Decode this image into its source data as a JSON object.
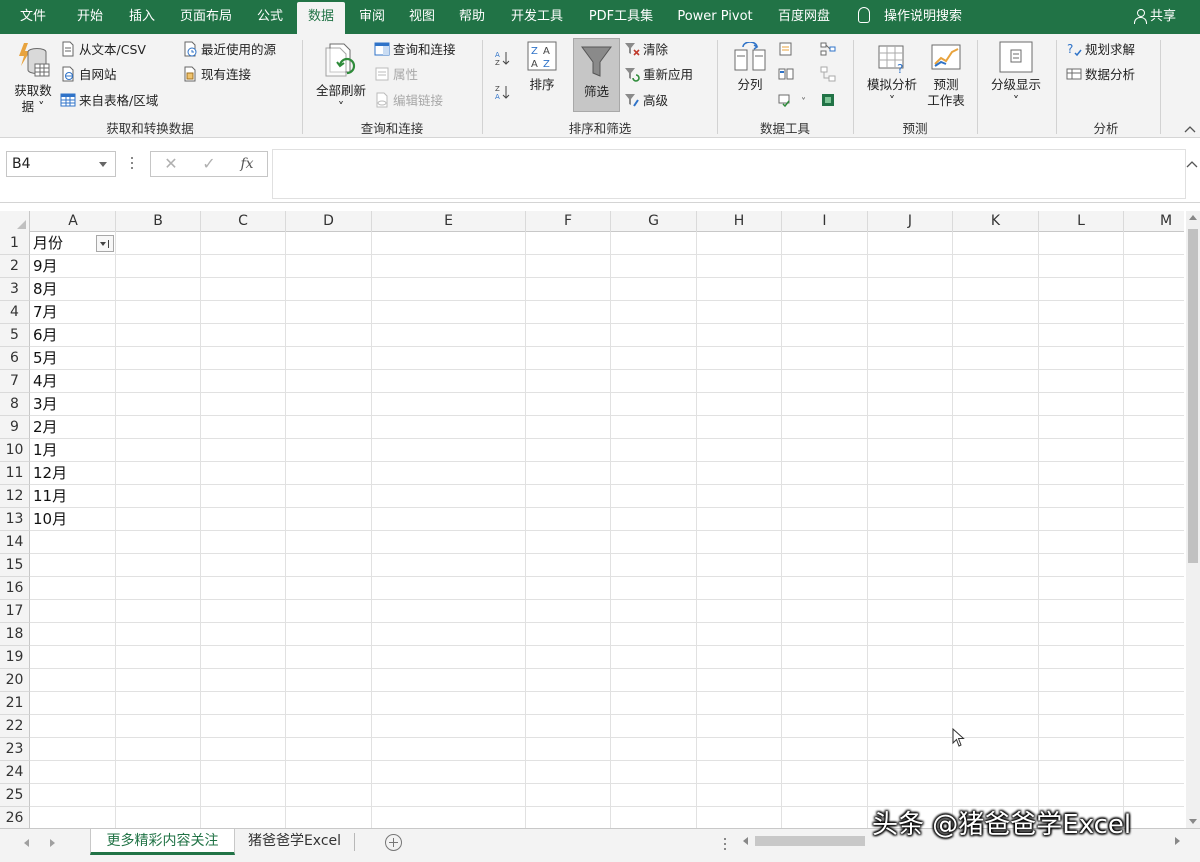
{
  "ribbon_tabs": [
    "文件",
    "开始",
    "插入",
    "页面布局",
    "公式",
    "数据",
    "审阅",
    "视图",
    "帮助",
    "开发工具",
    "PDF工具集",
    "Power Pivot",
    "百度网盘"
  ],
  "active_tab": "数据",
  "tell_me": "操作说明搜索",
  "share": "共享",
  "theme_color": "#217346",
  "groups": {
    "get_transform": {
      "label": "获取和转换数据",
      "get_data_line1": "获取数",
      "get_data_line2": "据 ˅",
      "from_text": "从文本/CSV",
      "from_web": "自网站",
      "from_table": "来自表格/区域",
      "recent_sources": "最近使用的源",
      "existing_connections": "现有连接"
    },
    "queries": {
      "label": "查询和连接",
      "refresh_all": "全部刷新",
      "queries_connections": "查询和连接",
      "properties": "属性",
      "edit_links": "编辑链接"
    },
    "sort_filter": {
      "label": "排序和筛选",
      "sort": "排序",
      "filter": "筛选",
      "clear": "清除",
      "reapply": "重新应用",
      "advanced": "高级"
    },
    "data_tools": {
      "label": "数据工具",
      "text_to_columns": "分列"
    },
    "forecast": {
      "label": "预测",
      "what_if": "模拟分析",
      "forecast_sheet_line1": "预测",
      "forecast_sheet_line2": "工作表"
    },
    "outline": {
      "outline": "分级显示"
    },
    "analysis": {
      "label": "分析",
      "solver": "规划求解",
      "data_analysis": "数据分析"
    }
  },
  "formula_bar": {
    "name_box": "B4",
    "cancel": "✕",
    "enter": "✓",
    "fx": "fx",
    "content": ""
  },
  "columns": [
    "A",
    "B",
    "C",
    "D",
    "E",
    "F",
    "G",
    "H",
    "I",
    "J",
    "K",
    "L",
    "M"
  ],
  "row_numbers": [
    "1",
    "2",
    "3",
    "4",
    "5",
    "6",
    "7",
    "8",
    "9",
    "10",
    "11",
    "12",
    "13",
    "14",
    "15",
    "16",
    "17",
    "18",
    "19",
    "20",
    "21",
    "22",
    "23",
    "24",
    "25",
    "26"
  ],
  "column_a": [
    "月份",
    "9月",
    "8月",
    "7月",
    "6月",
    "5月",
    "4月",
    "3月",
    "2月",
    "1月",
    "12月",
    "11月",
    "10月"
  ],
  "sheet_tabs": [
    "更多精彩内容关注",
    "猪爸爸学Excel"
  ],
  "active_sheet": "更多精彩内容关注",
  "watermark": "头条 @猪爸爸学Excel"
}
